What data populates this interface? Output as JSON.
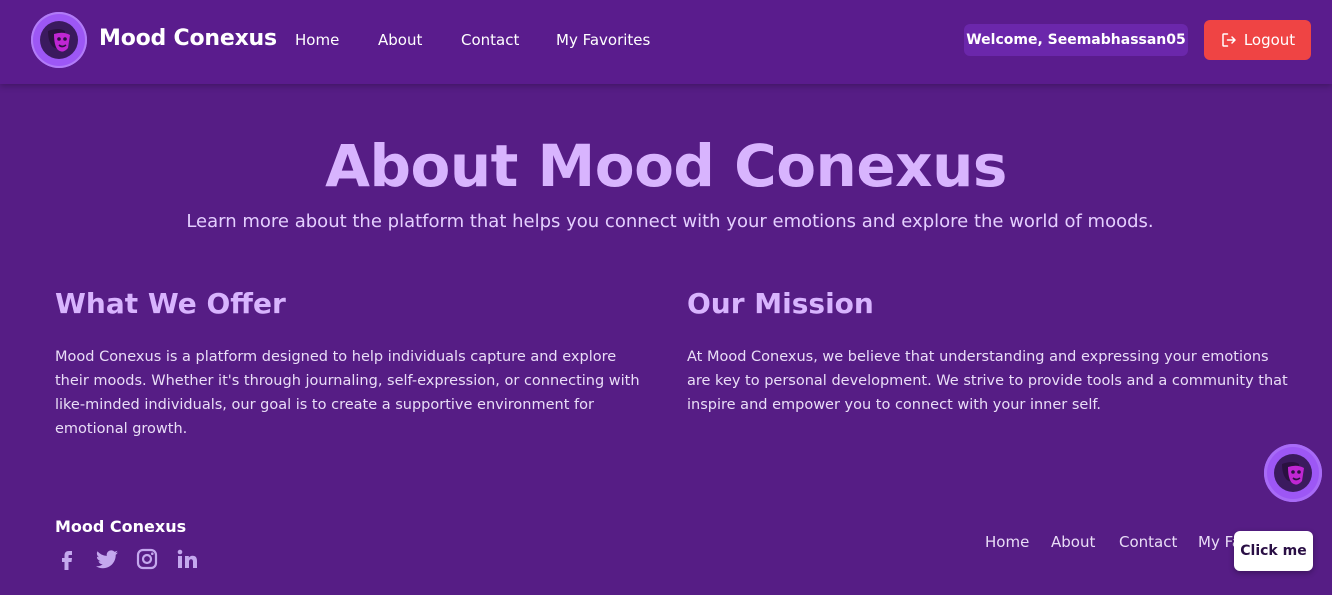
{
  "header": {
    "brand_name": "Mood Conexus",
    "nav": [
      "Home",
      "About",
      "Contact",
      "My Favorites"
    ],
    "welcome": "Welcome, Seemabhassan05",
    "logout_label": "Logout",
    "logout_icon": "logout-icon"
  },
  "hero": {
    "title": "About Mood Conexus",
    "subtitle": "Learn more about the platform that helps you connect with your emotions and explore the world of moods."
  },
  "sections": {
    "offer": {
      "title": "What We Offer",
      "text": "Mood Conexus is a platform designed to help individuals capture and explore their moods. Whether it's through journaling, self-expression, or connecting with like-minded individuals, our goal is to create a supportive environment for emotional growth."
    },
    "mission": {
      "title": "Our Mission",
      "text": "At Mood Conexus, we believe that understanding and expressing your emotions are key to personal development. We strive to provide tools and a community that inspire and empower you to connect with your inner self."
    }
  },
  "footer": {
    "brand": "Mood Conexus",
    "social_icons": [
      "facebook-icon",
      "twitter-icon",
      "instagram-icon",
      "linkedin-icon"
    ],
    "links": [
      "Home",
      "About",
      "Contact",
      "My Fa"
    ]
  },
  "chat_widget": {
    "label": "Click me"
  },
  "colors": {
    "background": "#561d85",
    "accent": "#d8b4fe",
    "logout": "#ef4444",
    "welcome_badge": "#6b27ab"
  }
}
